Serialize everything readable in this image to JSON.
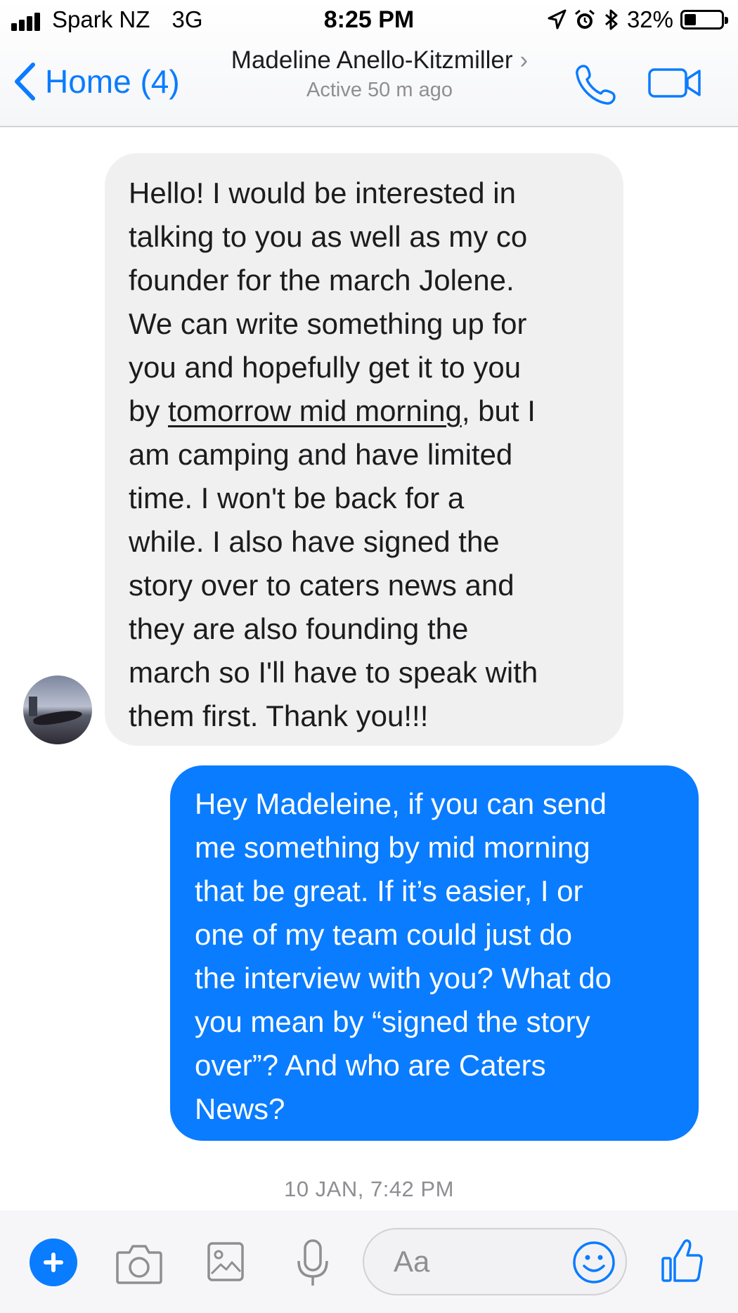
{
  "status_bar": {
    "carrier": "Spark NZ",
    "network": "3G",
    "time": "8:25 PM",
    "battery": "32%",
    "battery_level": 0.32,
    "icons": [
      "signal-icon",
      "location-arrow-icon",
      "alarm-icon",
      "bluetooth-icon",
      "battery-icon"
    ]
  },
  "header": {
    "back_label": "Home (4)",
    "contact_name": "Madeline Anello-Kitzmiller",
    "chevron": "›",
    "active_status": "Active 50 m ago",
    "icons": [
      "back-chevron-icon",
      "chevron-right-icon",
      "phone-icon",
      "video-camera-icon"
    ]
  },
  "messages": [
    {
      "direction": "incoming",
      "text_before": "Hello! I would be interested in\ntalking to you as well as my co\nfounder for the march Jolene.\nWe can write something up for\nyou and hopefully get it to you\nby ",
      "link": "tomorrow mid morning",
      "text_after": ", but I\nam camping and have limited\ntime. I won't be back for a\nwhile. I also have signed the\nstory over to caters news and\nthey are also founding the\nmarch so I'll have to speak with\nthem first. Thank you!!!"
    },
    {
      "direction": "outgoing",
      "text": "Hey Madeleine, if you can send\nme something by mid morning\nthat be great. If it’s easier, I or\none of my team could just do\nthe interview with you? What do\nyou mean by “signed the story\nover”? And who are Caters\nNews?"
    }
  ],
  "timestamp": "10 JAN, 7:42 PM",
  "composer": {
    "placeholder": "Aa",
    "icons": [
      "plus-icon",
      "camera-icon",
      "photo-icon",
      "microphone-icon",
      "emoji-icon",
      "thumbs-up-icon"
    ]
  },
  "colors": {
    "accent": "#0a7cff",
    "incoming_bubble": "#f0f0f0",
    "secondary_text": "#8e8e93"
  }
}
